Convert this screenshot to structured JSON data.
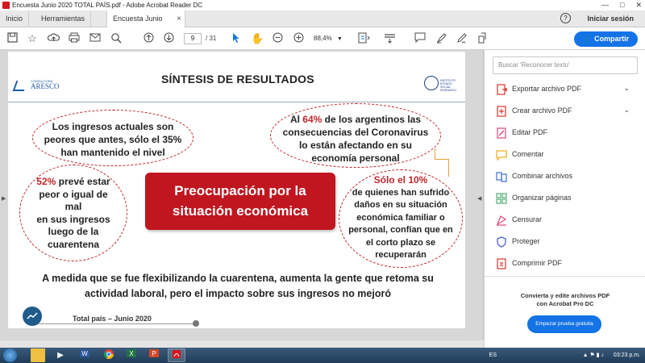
{
  "window": {
    "title": "Encuesta Junio 2020 TOTAL PAÍS.pdf - Adobe Acrobat Reader DC",
    "minimize": "—",
    "maximize": "□",
    "close": "✕"
  },
  "tabs": {
    "home": "Inicio",
    "tools": "Herramientas",
    "document": "Encuesta Junio 202...",
    "close": "×",
    "help": "?",
    "signin": "Iniciar sesión"
  },
  "toolbar": {
    "page_current": "9",
    "page_total": "/ 31",
    "zoom": "88,4%",
    "share_label": "Compartir"
  },
  "slide": {
    "title": "SÍNTESIS DE RESULTADOS",
    "logo_left_sub": "CONSULTORA",
    "logo_left_name": "ARESCO",
    "logo_right_text": "INSTITUTO ESTADO SOCIAL RESEARCH",
    "oval1": {
      "line1": "Los ingresos actuales son",
      "line2": "peores que antes, sólo el 35%",
      "line3": "han mantenido el nivel"
    },
    "oval2": {
      "pre": "Al ",
      "pct": "64%",
      "post": " de los argentinos las",
      "line2": "consecuencias del Coronavirus",
      "line3": "lo están afectando en su",
      "line4": "economía personal"
    },
    "oval3": {
      "pct": "52%",
      "post": " prevé estar",
      "line2": "peor o igual de",
      "line3": "mal",
      "line4": "en sus ingresos",
      "line5": "luego de la",
      "line6": "cuarentena"
    },
    "oval4": {
      "head": "Sólo el 10%",
      "line2": "de quienes han sufrido",
      "line3": "daños en su situación",
      "line4": "económica familiar o",
      "line5": "personal, confían que en",
      "line6": "el corto  plazo se",
      "line7": "recuperarán"
    },
    "center_line1": "Preocupación por la",
    "center_line2": "situación económica",
    "bottom_line1": "A medida que se fue flexibilizando la cuarentena, aumenta la gente que retoma su",
    "bottom_line2": "actividad laboral, pero el impacto sobre sus ingresos no mejoró",
    "footer_label": "Total país – Junio 2020"
  },
  "right_pane": {
    "search_placeholder": "Buscar 'Reconocer texto'",
    "tools": [
      {
        "label": "Exportar archivo PDF",
        "icon": "export-pdf-icon",
        "color": "#d9332c",
        "chevron": "⌄"
      },
      {
        "label": "Crear archivo PDF",
        "icon": "create-pdf-icon",
        "color": "#d9332c",
        "chevron": "⌄"
      },
      {
        "label": "Editar PDF",
        "icon": "edit-pdf-icon",
        "color": "#e0457b"
      },
      {
        "label": "Comentar",
        "icon": "comment-icon",
        "color": "#f2b01e"
      },
      {
        "label": "Combinar archivos",
        "icon": "combine-files-icon",
        "color": "#3b6fd1"
      },
      {
        "label": "Organizar páginas",
        "icon": "organize-pages-icon",
        "color": "#2f9c5a"
      },
      {
        "label": "Censurar",
        "icon": "redact-icon",
        "color": "#e0457b"
      },
      {
        "label": "Proteger",
        "icon": "protect-icon",
        "color": "#4b5fd1"
      },
      {
        "label": "Comprimir PDF",
        "icon": "compress-pdf-icon",
        "color": "#d9332c"
      }
    ],
    "promo_line1": "Convierta y edite archivos PDF",
    "promo_line2": "con Acrobat Pro DC",
    "promo_button": "Empezar prueba gratuita"
  },
  "taskbar": {
    "lang": "ES",
    "clock": "03:23 p.m."
  },
  "colors": {
    "accent_red": "#c0161f",
    "acrobat_blue": "#1473e6"
  }
}
